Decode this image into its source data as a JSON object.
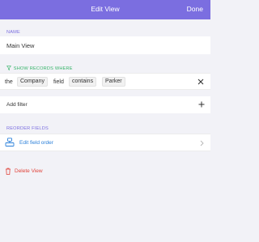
{
  "header": {
    "title": "Edit View",
    "done_label": "Done"
  },
  "name_section": {
    "label": "NAME",
    "value": "Main View"
  },
  "filter_section": {
    "label": "SHOW RECORDS WHERE",
    "condition": {
      "prefix": "the",
      "field_name": "Company",
      "word_field": "field",
      "operator": "contains",
      "value": "Parker"
    }
  },
  "add_filter": {
    "label": "Add filter"
  },
  "reorder_section": {
    "label": "REORDER FIELDS",
    "edit_label": "Edit field order"
  },
  "delete": {
    "label": "Delete View"
  },
  "colors": {
    "header_bg": "#7b6ee0",
    "section_purple": "#7b6ee0",
    "filter_green": "#35b368",
    "link_blue": "#2a7fd9",
    "delete_red": "#e0443b",
    "background": "#f2f2f7"
  },
  "icons": [
    "filter-icon",
    "close-icon",
    "plus-icon",
    "fields-icon",
    "chevron-right-icon",
    "trash-icon"
  ]
}
